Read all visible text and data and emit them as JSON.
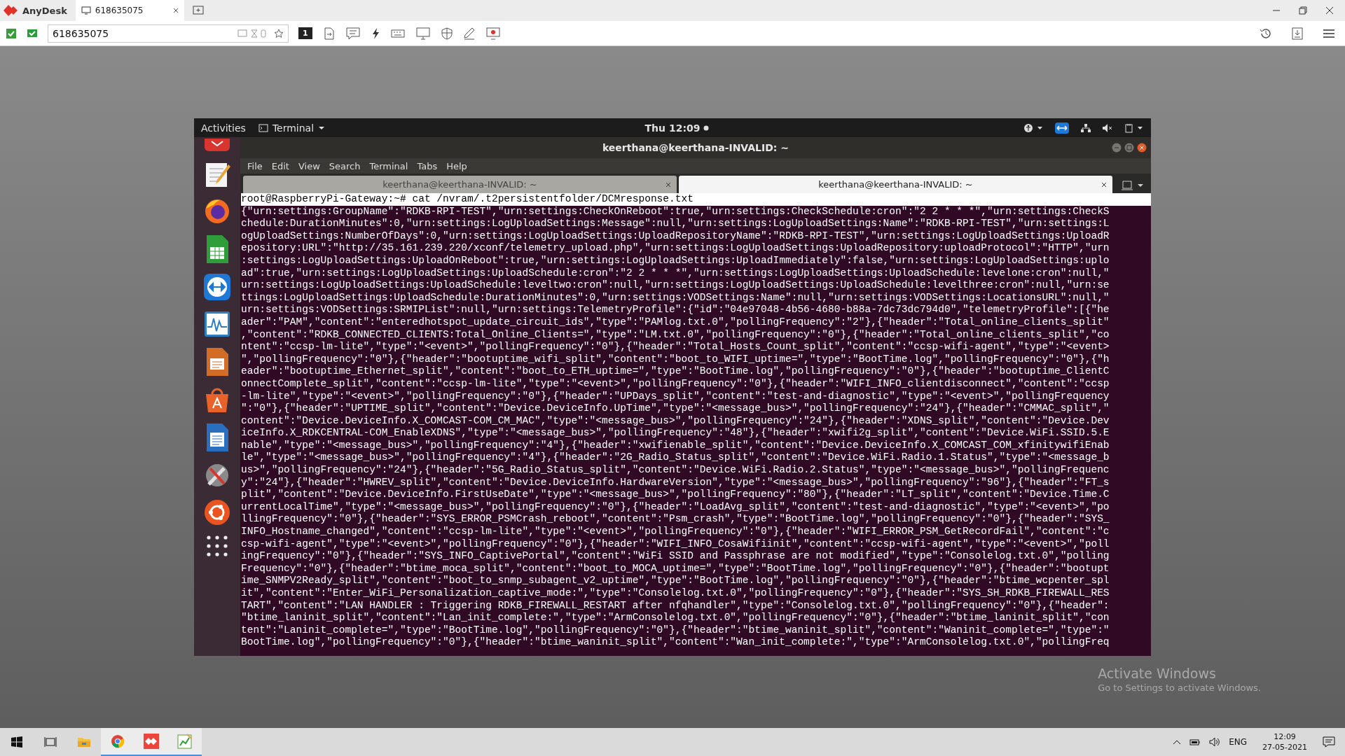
{
  "anydesk": {
    "app_name": "AnyDesk",
    "tabs": [
      {
        "label": "618635075",
        "selected": true
      }
    ],
    "address": "618635075",
    "display_number": "1"
  },
  "remote": {
    "topbar": {
      "activities": "Activities",
      "app_menu": "Terminal",
      "clock": "Thu 12:09"
    },
    "terminal": {
      "title": "keerthana@keerthana-INVALID: ~",
      "menu": [
        "File",
        "Edit",
        "View",
        "Search",
        "Terminal",
        "Tabs",
        "Help"
      ],
      "tabs": [
        {
          "label": "keerthana@keerthana-INVALID: ~",
          "selected": false
        },
        {
          "label": "keerthana@keerthana-INVALID: ~",
          "selected": true
        }
      ],
      "prompt_line": "root@RaspberryPi-Gateway:~# cat /nvram/.t2persistentfolder/DCMresponse.txt",
      "output_lines": [
        "{\"urn:settings:GroupName\":\"RDKB-RPI-TEST\",\"urn:settings:CheckOnReboot\":true,\"urn:settings:CheckSchedule:cron\":\"2 2 * * *\",\"urn:settings:CheckS",
        "chedule:DurationMinutes\":0,\"urn:settings:LogUploadSettings:Message\":null,\"urn:settings:LogUploadSettings:Name\":\"RDKB-RPI-TEST\",\"urn:settings:L",
        "ogUploadSettings:NumberOfDays\":0,\"urn:settings:LogUploadSettings:UploadRepositoryName\":\"RDKB-RPI-TEST\",\"urn:settings:LogUploadSettings:UploadR",
        "epository:URL\":\"http://35.161.239.220/xconf/telemetry_upload.php\",\"urn:settings:LogUploadSettings:UploadRepository:uploadProtocol\":\"HTTP\",\"urn",
        ":settings:LogUploadSettings:UploadOnReboot\":true,\"urn:settings:LogUploadSettings:UploadImmediately\":false,\"urn:settings:LogUploadSettings:uplo",
        "ad\":true,\"urn:settings:LogUploadSettings:UploadSchedule:cron\":\"2 2 * * *\",\"urn:settings:LogUploadSettings:UploadSchedule:levelone:cron\":null,\"",
        "urn:settings:LogUploadSettings:UploadSchedule:leveltwo:cron\":null,\"urn:settings:LogUploadSettings:UploadSchedule:levelthree:cron\":null,\"urn:se",
        "ttings:LogUploadSettings:UploadSchedule:DurationMinutes\":0,\"urn:settings:VODSettings:Name\":null,\"urn:settings:VODSettings:LocationsURL\":null,\"",
        "urn:settings:VODSettings:SRMIPList\":null,\"urn:settings:TelemetryProfile\":{\"id\":\"04e97048-4b56-4680-b88a-7dc73dc794d0\",\"telemetryProfile\":[{\"he",
        "ader\":\"PAM\",\"content\":\"enteredhotspot_update_circuit_ids\",\"type\":\"PAMlog.txt.0\",\"pollingFrequency\":\"2\"},{\"header\":\"Total_online_clients_split\"",
        ",\"content\":\"RDKB_CONNECTED_CLIENTS:Total_Online_Clients=\",\"type\":\"LM.txt.0\",\"pollingFrequency\":\"0\"},{\"header\":\"Total_online_clients_split\",\"co",
        "ntent\":\"ccsp-lm-lite\",\"type\":\"<event>\",\"pollingFrequency\":\"0\"},{\"header\":\"Total_Hosts_Count_split\",\"content\":\"ccsp-wifi-agent\",\"type\":\"<event>",
        "\",\"pollingFrequency\":\"0\"},{\"header\":\"bootuptime_wifi_split\",\"content\":\"boot_to_WIFI_uptime=\",\"type\":\"BootTime.log\",\"pollingFrequency\":\"0\"},{\"h",
        "eader\":\"bootuptime_Ethernet_split\",\"content\":\"boot_to_ETH_uptime=\",\"type\":\"BootTime.log\",\"pollingFrequency\":\"0\"},{\"header\":\"bootuptime_ClientC",
        "onnectComplete_split\",\"content\":\"ccsp-lm-lite\",\"type\":\"<event>\",\"pollingFrequency\":\"0\"},{\"header\":\"WIFI_INFO_clientdisconnect\",\"content\":\"ccsp",
        "-lm-lite\",\"type\":\"<event>\",\"pollingFrequency\":\"0\"},{\"header\":\"UPDays_split\",\"content\":\"test-and-diagnostic\",\"type\":\"<event>\",\"pollingFrequency",
        "\":\"0\"},{\"header\":\"UPTIME_split\",\"content\":\"Device.DeviceInfo.UpTime\",\"type\":\"<message_bus>\",\"pollingFrequency\":\"24\"},{\"header\":\"CMMAC_split\",\"",
        "content\":\"Device.DeviceInfo.X_COMCAST-COM_CM_MAC\",\"type\":\"<message_bus>\",\"pollingFrequency\":\"24\"},{\"header\":\"XDNS_split\",\"content\":\"Device.Dev",
        "iceInfo.X_RDKCENTRAL-COM_EnableXDNS\",\"type\":\"<message_bus>\",\"pollingFrequency\":\"48\"},{\"header\":\"xwifi2g_split\",\"content\":\"Device.WiFi.SSID.5.E",
        "nable\",\"type\":\"<message_bus>\",\"pollingFrequency\":\"4\"},{\"header\":\"xwifienable_split\",\"content\":\"Device.DeviceInfo.X_COMCAST_COM_xfinitywifiEnab",
        "le\",\"type\":\"<message_bus>\",\"pollingFrequency\":\"4\"},{\"header\":\"2G_Radio_Status_split\",\"content\":\"Device.WiFi.Radio.1.Status\",\"type\":\"<message_b",
        "us>\",\"pollingFrequency\":\"24\"},{\"header\":\"5G_Radio_Status_split\",\"content\":\"Device.WiFi.Radio.2.Status\",\"type\":\"<message_bus>\",\"pollingFrequenc",
        "y\":\"24\"},{\"header\":\"HWREV_split\",\"content\":\"Device.DeviceInfo.HardwareVersion\",\"type\":\"<message_bus>\",\"pollingFrequency\":\"96\"},{\"header\":\"FT_s",
        "plit\",\"content\":\"Device.DeviceInfo.FirstUseDate\",\"type\":\"<message_bus>\",\"pollingFrequency\":\"80\"},{\"header\":\"LT_split\",\"content\":\"Device.Time.C",
        "urrentLocalTime\",\"type\":\"<message_bus>\",\"pollingFrequency\":\"0\"},{\"header\":\"LoadAvg_split\",\"content\":\"test-and-diagnostic\",\"type\":\"<event>\",\"po",
        "llingFrequency\":\"0\"},{\"header\":\"SYS_ERROR_PSMCrash_reboot\",\"content\":\"Psm_crash\",\"type\":\"BootTime.log\",\"pollingFrequency\":\"0\"},{\"header\":\"SYS_",
        "INFO_Hostname_changed\",\"content\":\"ccsp-lm-lite\",\"type\":\"<event>\",\"pollingFrequency\":\"0\"},{\"header\":\"WIFI_ERROR_PSM_GetRecordFail\",\"content\":\"c",
        "csp-wifi-agent\",\"type\":\"<event>\",\"pollingFrequency\":\"0\"},{\"header\":\"WIFI_INFO_CosaWifiinit\",\"content\":\"ccsp-wifi-agent\",\"type\":\"<event>\",\"poll",
        "ingFrequency\":\"0\"},{\"header\":\"SYS_INFO_CaptivePortal\",\"content\":\"WiFi SSID and Passphrase are not modified\",\"type\":\"Consolelog.txt.0\",\"polling",
        "Frequency\":\"0\"},{\"header\":\"btime_moca_split\",\"content\":\"boot_to_MOCA_uptime=\",\"type\":\"BootTime.log\",\"pollingFrequency\":\"0\"},{\"header\":\"bootupt",
        "ime_SNMPV2Ready_split\",\"content\":\"boot_to_snmp_subagent_v2_uptime\",\"type\":\"BootTime.log\",\"pollingFrequency\":\"0\"},{\"header\":\"btime_wcpenter_spl",
        "it\",\"content\":\"Enter_WiFi_Personalization_captive_mode:\",\"type\":\"Consolelog.txt.0\",\"pollingFrequency\":\"0\"},{\"header\":\"SYS_SH_RDKB_FIREWALL_RES",
        "TART\",\"content\":\"LAN HANDLER : Triggering RDKB_FIREWALL_RESTART after nfqhandler\",\"type\":\"Consolelog.txt.0\",\"pollingFrequency\":\"0\"},{\"header\":",
        "\"btime_laninit_split\",\"content\":\"Lan_init_complete:\",\"type\":\"ArmConsolelog.txt.0\",\"pollingFrequency\":\"0\"},{\"header\":\"btime_laninit_split\",\"con",
        "tent\":\"Laninit_complete=\",\"type\":\"BootTime.log\",\"pollingFrequency\":\"0\"},{\"header\":\"btime_waninit_split\",\"content\":\"Waninit_complete=\",\"type\":\"",
        "BootTime.log\",\"pollingFrequency\":\"0\"},{\"header\":\"btime_waninit_split\",\"content\":\"Wan_init_complete:\",\"type\":\"ArmConsolelog.txt.0\",\"pollingFreq"
      ]
    }
  },
  "activation_notice": {
    "title": "Activate Windows",
    "subtitle": "Go to Settings to activate Windows."
  },
  "taskbar": {
    "language": "ENG",
    "time": "12:09",
    "date": "27-05-2021"
  }
}
